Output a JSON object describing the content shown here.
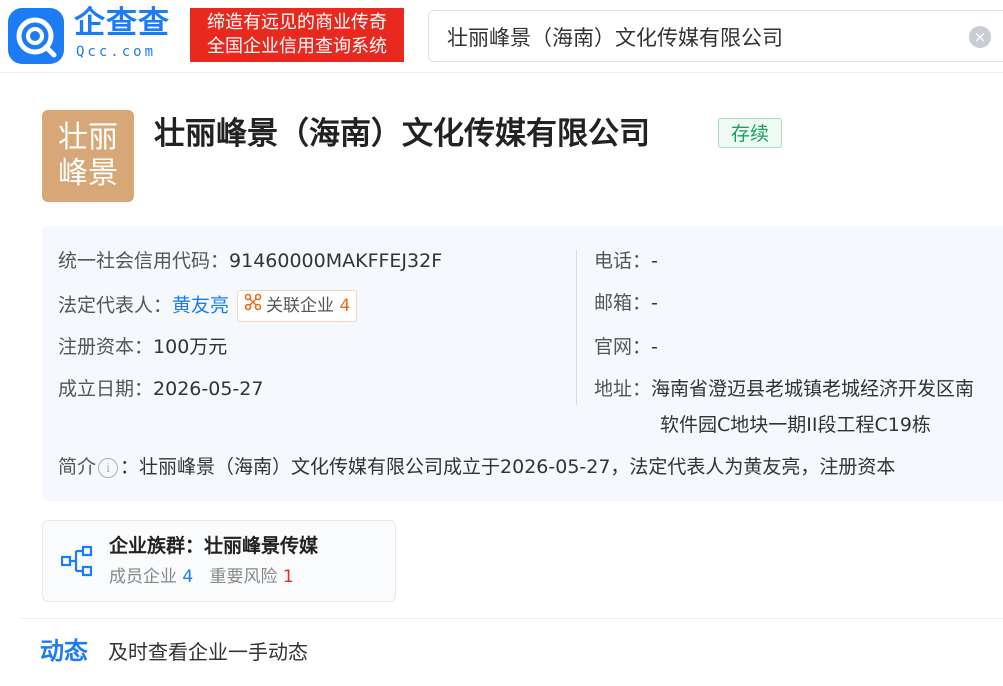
{
  "brand": {
    "name": "企查查",
    "sub": "Qcc.com",
    "slogan_line1": "缔造有远见的商业传奇",
    "slogan_line2": "全国企业信用查询系统"
  },
  "search": {
    "value": "壮丽峰景（海南）文化传媒有限公司",
    "clear_icon": "clear-icon"
  },
  "company": {
    "avatar_line1": "壮丽",
    "avatar_line2": "峰景",
    "title": "壮丽峰景（海南）文化传媒有限公司",
    "status": "存续",
    "status_color": "#19a15f"
  },
  "info": {
    "credit_code_label": "统一社会信用代码：",
    "credit_code": "91460000MAKFFEJ32F",
    "legal_rep_label": "法定代表人：",
    "legal_rep": "黄友亮",
    "related_label": "关联企业",
    "related_count": "4",
    "capital_label": "注册资本：",
    "capital": "100万元",
    "founded_label": "成立日期：",
    "founded": "2026-05-27",
    "phone_label": "电话：",
    "phone": "-",
    "email_label": "邮箱：",
    "email": "-",
    "website_label": "官网：",
    "website": "-",
    "address_label": "地址：",
    "address_line1": "海南省澄迈县老城镇老城经济开发区南",
    "address_line2": "软件园C地块一期II段工程C19栋",
    "intro_label": "简介",
    "intro": "：壮丽峰景（海南）文化传媒有限公司成立于2026-05-27，法定代表人为黄友亮，注册资本"
  },
  "group": {
    "title": "企业族群：壮丽峰景传媒",
    "members_label": "成员企业",
    "members_count": "4",
    "risk_label": "重要风险",
    "risk_count": "1"
  },
  "dynamics": {
    "title": "动态",
    "subtitle": "及时查看企业一手动态"
  },
  "colors": {
    "brand_blue": "#1c7cf4",
    "slogan_red": "#e8291f",
    "avatar_tan": "#d7a777"
  }
}
